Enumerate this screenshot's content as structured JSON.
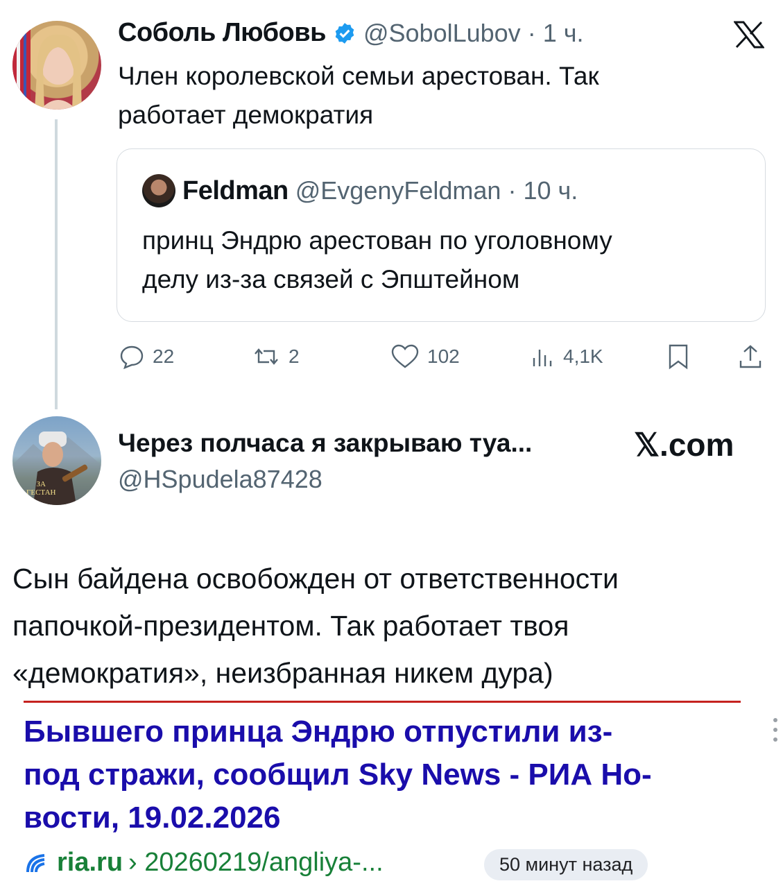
{
  "tweet1": {
    "author_name": "Соболь Любовь",
    "handle": "@SobolLubov",
    "time": "1 ч.",
    "line1": "Член королевской семьи арестован. Так",
    "line2": "работает демократия",
    "quote": {
      "author_name": "Feldman",
      "handle": "@EvgenyFeldman",
      "time": "10 ч.",
      "line1": "принц Эндрю арестован по уголовному",
      "line2": "делу из-за связей с Эпштейном"
    },
    "actions": {
      "replies": "22",
      "reposts": "2",
      "likes": "102",
      "views": "4,1K"
    }
  },
  "tweet2": {
    "author_name": "Через полчаса я закрываю туа...",
    "handle": "@HSpudela87428",
    "brand": "𝕏.com",
    "avatar_caption_1": "ЗА",
    "avatar_caption_2": "ГЕСТАН",
    "line1": "Сын байдена освобожден от ответственности",
    "line2": "папочкой-президентом. Так работает твоя",
    "line3": "«демократия», неизбранная никем дура)"
  },
  "search_result": {
    "title_line1": "Бывшего принца Эндрю отпустили из-",
    "title_line2": "под стражи, сообщил Sky News - РИА Но-",
    "title_line3": "вости, 19.02.2026",
    "site": "ria.ru",
    "path": "› 20260219/angliya-...",
    "time_badge": "50 минут назад"
  },
  "colors": {
    "verified": "#1d9bf0",
    "link": "#1a0dab",
    "url_green": "#188038",
    "divider": "#c5221f",
    "muted": "#536471"
  }
}
